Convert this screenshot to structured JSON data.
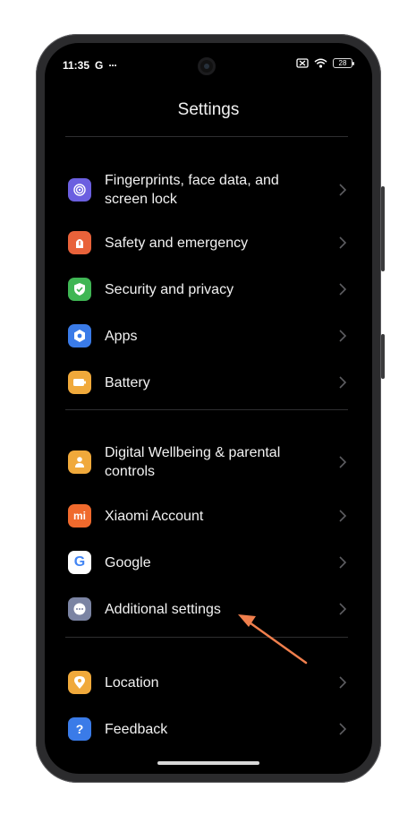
{
  "status_bar": {
    "time": "11:35",
    "notification_g": "G",
    "more_dots": "···",
    "battery_level": "28"
  },
  "header": {
    "title": "Settings"
  },
  "sections": [
    {
      "items": [
        {
          "label": "Fingerprints, face data, and screen lock",
          "icon": "fingerprint-icon",
          "icon_color": "#6b5fe0"
        },
        {
          "label": "Safety and emergency",
          "icon": "emergency-icon",
          "icon_color": "#e8623a"
        },
        {
          "label": "Security and privacy",
          "icon": "shield-check-icon",
          "icon_color": "#3fb654"
        },
        {
          "label": "Apps",
          "icon": "apps-icon",
          "icon_color": "#3a7be8"
        },
        {
          "label": "Battery",
          "icon": "battery-icon",
          "icon_color": "#f0a93b"
        }
      ]
    },
    {
      "items": [
        {
          "label": "Digital Wellbeing & parental controls",
          "icon": "wellbeing-icon",
          "icon_color": "#f0a93b"
        },
        {
          "label": "Xiaomi Account",
          "icon": "mi-icon",
          "icon_color": "#f06a2d",
          "icon_text": "mi"
        },
        {
          "label": "Google",
          "icon": "google-icon",
          "icon_color": "#ffffff",
          "icon_text": "G"
        },
        {
          "label": "Additional settings",
          "icon": "more-dots-icon",
          "icon_color": "#7b84a3"
        }
      ]
    },
    {
      "items": [
        {
          "label": "Location",
          "icon": "location-pin-icon",
          "icon_color": "#f0a93b"
        },
        {
          "label": "Feedback",
          "icon": "feedback-icon",
          "icon_color": "#3a7be8",
          "icon_text": "?"
        }
      ]
    }
  ],
  "annotation_color": "#f07f4d"
}
